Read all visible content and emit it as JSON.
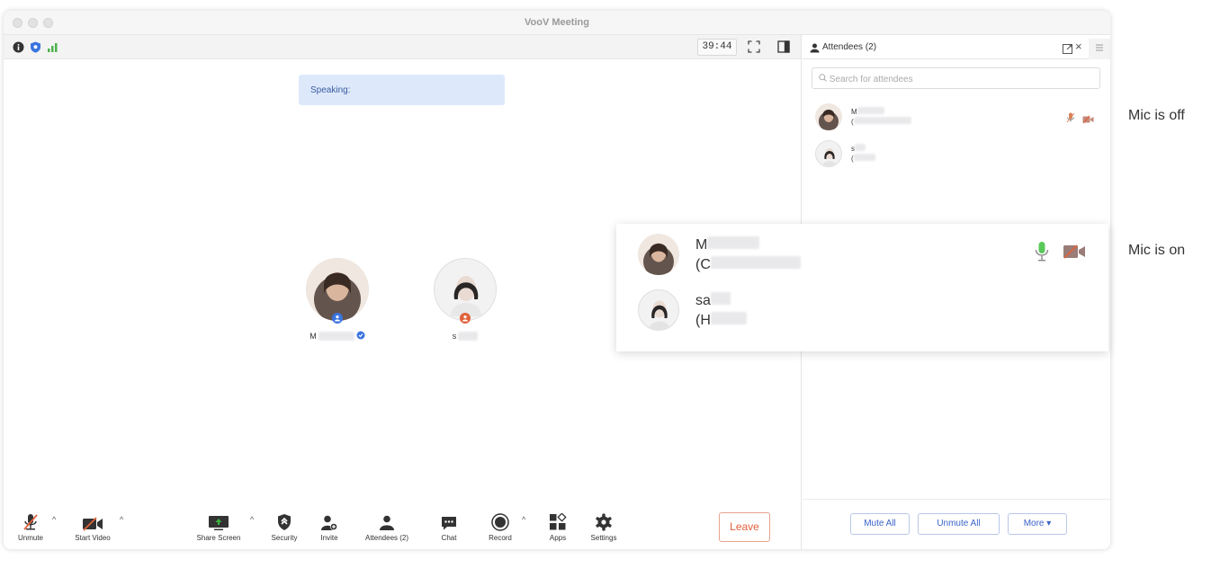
{
  "window": {
    "title": "VooV Meeting"
  },
  "topbar": {
    "timer": "39:44"
  },
  "stage": {
    "speaking_label": "Speaking:",
    "participants": [
      {
        "name_initial": "M"
      },
      {
        "name_initial": "s"
      }
    ]
  },
  "toolbar": {
    "unmute": "Unmute",
    "start_video": "Start Video",
    "share_screen": "Share Screen",
    "security": "Security",
    "invite": "Invite",
    "attendees": "Attendees (2)",
    "chat": "Chat",
    "record": "Record",
    "apps": "Apps",
    "settings": "Settings",
    "leave": "Leave"
  },
  "sidebar": {
    "title": "Attendees (2)",
    "search_placeholder": "Search for attendees",
    "attendees": [
      {
        "line1": "M",
        "line2": "("
      },
      {
        "line1": "s",
        "line2": "("
      }
    ],
    "buttons": {
      "mute_all": "Mute All",
      "unmute_all": "Unmute All",
      "more": "More ▾"
    }
  },
  "callout": {
    "rows": [
      {
        "line1": "M",
        "line2": "(C"
      },
      {
        "line1": "sa",
        "line2": "(H"
      }
    ]
  },
  "annotations": {
    "mic_off": "Mic is off",
    "mic_on": "Mic is on"
  },
  "colors": {
    "accent_blue": "#3a63c8",
    "leave_red": "#e2613a",
    "mic_on_green": "#5ac85a",
    "mic_off_orange": "#d9825b"
  }
}
